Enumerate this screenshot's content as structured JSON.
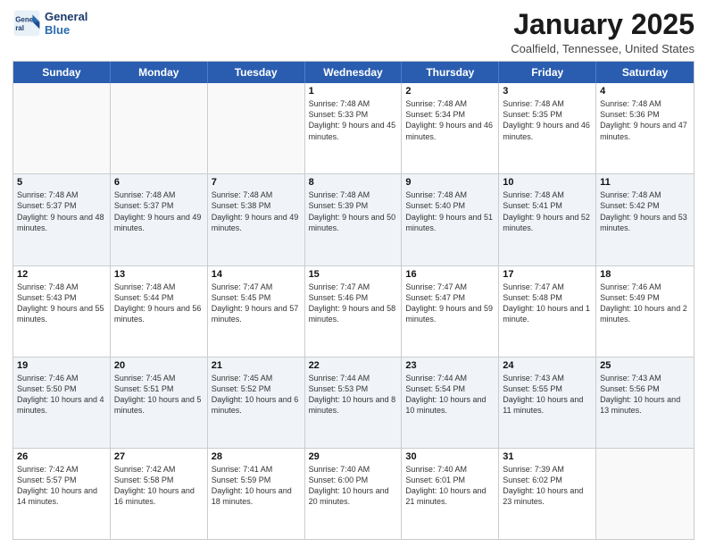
{
  "logo": {
    "text_general": "General",
    "text_blue": "Blue"
  },
  "header": {
    "month": "January 2025",
    "location": "Coalfield, Tennessee, United States"
  },
  "day_headers": [
    "Sunday",
    "Monday",
    "Tuesday",
    "Wednesday",
    "Thursday",
    "Friday",
    "Saturday"
  ],
  "weeks": [
    [
      {
        "day": "",
        "empty": true
      },
      {
        "day": "",
        "empty": true
      },
      {
        "day": "",
        "empty": true
      },
      {
        "day": "1",
        "sunrise": "7:48 AM",
        "sunset": "5:33 PM",
        "daylight": "9 hours and 45 minutes."
      },
      {
        "day": "2",
        "sunrise": "7:48 AM",
        "sunset": "5:34 PM",
        "daylight": "9 hours and 46 minutes."
      },
      {
        "day": "3",
        "sunrise": "7:48 AM",
        "sunset": "5:35 PM",
        "daylight": "9 hours and 46 minutes."
      },
      {
        "day": "4",
        "sunrise": "7:48 AM",
        "sunset": "5:36 PM",
        "daylight": "9 hours and 47 minutes."
      }
    ],
    [
      {
        "day": "5",
        "sunrise": "7:48 AM",
        "sunset": "5:37 PM",
        "daylight": "9 hours and 48 minutes."
      },
      {
        "day": "6",
        "sunrise": "7:48 AM",
        "sunset": "5:37 PM",
        "daylight": "9 hours and 49 minutes."
      },
      {
        "day": "7",
        "sunrise": "7:48 AM",
        "sunset": "5:38 PM",
        "daylight": "9 hours and 49 minutes."
      },
      {
        "day": "8",
        "sunrise": "7:48 AM",
        "sunset": "5:39 PM",
        "daylight": "9 hours and 50 minutes."
      },
      {
        "day": "9",
        "sunrise": "7:48 AM",
        "sunset": "5:40 PM",
        "daylight": "9 hours and 51 minutes."
      },
      {
        "day": "10",
        "sunrise": "7:48 AM",
        "sunset": "5:41 PM",
        "daylight": "9 hours and 52 minutes."
      },
      {
        "day": "11",
        "sunrise": "7:48 AM",
        "sunset": "5:42 PM",
        "daylight": "9 hours and 53 minutes."
      }
    ],
    [
      {
        "day": "12",
        "sunrise": "7:48 AM",
        "sunset": "5:43 PM",
        "daylight": "9 hours and 55 minutes."
      },
      {
        "day": "13",
        "sunrise": "7:48 AM",
        "sunset": "5:44 PM",
        "daylight": "9 hours and 56 minutes."
      },
      {
        "day": "14",
        "sunrise": "7:47 AM",
        "sunset": "5:45 PM",
        "daylight": "9 hours and 57 minutes."
      },
      {
        "day": "15",
        "sunrise": "7:47 AM",
        "sunset": "5:46 PM",
        "daylight": "9 hours and 58 minutes."
      },
      {
        "day": "16",
        "sunrise": "7:47 AM",
        "sunset": "5:47 PM",
        "daylight": "9 hours and 59 minutes."
      },
      {
        "day": "17",
        "sunrise": "7:47 AM",
        "sunset": "5:48 PM",
        "daylight": "10 hours and 1 minute."
      },
      {
        "day": "18",
        "sunrise": "7:46 AM",
        "sunset": "5:49 PM",
        "daylight": "10 hours and 2 minutes."
      }
    ],
    [
      {
        "day": "19",
        "sunrise": "7:46 AM",
        "sunset": "5:50 PM",
        "daylight": "10 hours and 4 minutes."
      },
      {
        "day": "20",
        "sunrise": "7:45 AM",
        "sunset": "5:51 PM",
        "daylight": "10 hours and 5 minutes."
      },
      {
        "day": "21",
        "sunrise": "7:45 AM",
        "sunset": "5:52 PM",
        "daylight": "10 hours and 6 minutes."
      },
      {
        "day": "22",
        "sunrise": "7:44 AM",
        "sunset": "5:53 PM",
        "daylight": "10 hours and 8 minutes."
      },
      {
        "day": "23",
        "sunrise": "7:44 AM",
        "sunset": "5:54 PM",
        "daylight": "10 hours and 10 minutes."
      },
      {
        "day": "24",
        "sunrise": "7:43 AM",
        "sunset": "5:55 PM",
        "daylight": "10 hours and 11 minutes."
      },
      {
        "day": "25",
        "sunrise": "7:43 AM",
        "sunset": "5:56 PM",
        "daylight": "10 hours and 13 minutes."
      }
    ],
    [
      {
        "day": "26",
        "sunrise": "7:42 AM",
        "sunset": "5:57 PM",
        "daylight": "10 hours and 14 minutes."
      },
      {
        "day": "27",
        "sunrise": "7:42 AM",
        "sunset": "5:58 PM",
        "daylight": "10 hours and 16 minutes."
      },
      {
        "day": "28",
        "sunrise": "7:41 AM",
        "sunset": "5:59 PM",
        "daylight": "10 hours and 18 minutes."
      },
      {
        "day": "29",
        "sunrise": "7:40 AM",
        "sunset": "6:00 PM",
        "daylight": "10 hours and 20 minutes."
      },
      {
        "day": "30",
        "sunrise": "7:40 AM",
        "sunset": "6:01 PM",
        "daylight": "10 hours and 21 minutes."
      },
      {
        "day": "31",
        "sunrise": "7:39 AM",
        "sunset": "6:02 PM",
        "daylight": "10 hours and 23 minutes."
      },
      {
        "day": "",
        "empty": true
      }
    ]
  ]
}
